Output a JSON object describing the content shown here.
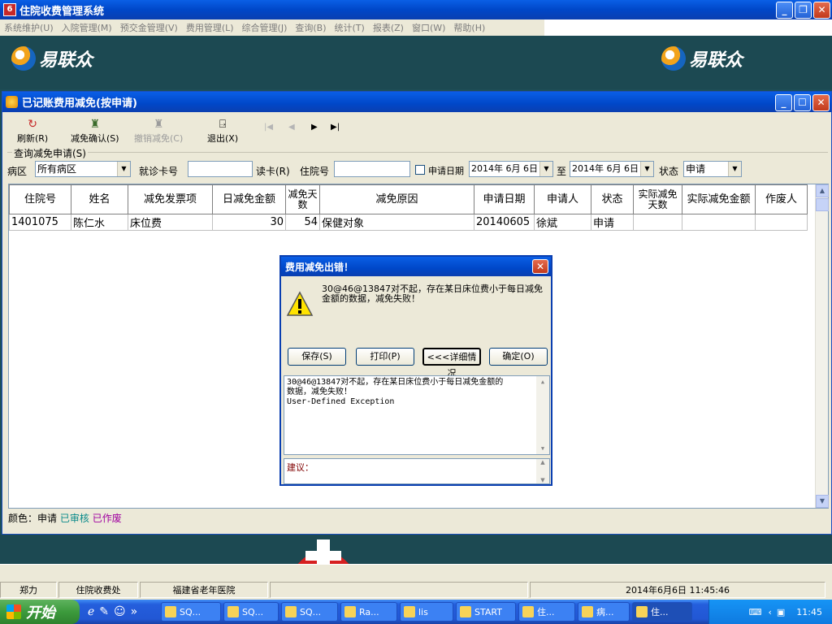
{
  "app": {
    "title": "住院收费管理系统",
    "icon_text": "6"
  },
  "menu": {
    "items": [
      "系统维护(U)",
      "入院管理(M)",
      "预交金管理(V)",
      "费用管理(L)",
      "综合管理(J)",
      "查询(B)",
      "统计(T)",
      "报表(Z)",
      "窗口(W)",
      "帮助(H)"
    ]
  },
  "banner": {
    "logo_text": "易联众"
  },
  "child": {
    "title": "已记账费用减免(按申请)",
    "toolbar": {
      "refresh": "刷新(R)",
      "confirm": "减免确认(S)",
      "cancel": "撤销减免(C)",
      "exit": "退出(X)",
      "nav_first": "|◀",
      "nav_prev": "◀",
      "nav_next": "▶",
      "nav_last": "▶|"
    },
    "query": {
      "legend": "查询减免申请(S)",
      "ward_label": "病区",
      "ward_value": "所有病区",
      "card_label": "就诊卡号",
      "card_value": "",
      "read_card": "读卡(R)",
      "inpatient_label": "住院号",
      "inpatient_value": "",
      "date_check_label": "申请日期",
      "date_from": "2014年 6月 6日",
      "date_to_label": "至",
      "date_to": "2014年 6月 6日",
      "status_label": "状态",
      "status_value": "申请"
    },
    "table": {
      "headers": [
        "住院号",
        "姓名",
        "减免发票项",
        "日减免金额",
        "减免天数",
        "减免原因",
        "申请日期",
        "申请人",
        "状态",
        "实际减免天数",
        "实际减免金额",
        "作废人"
      ],
      "rows": [
        [
          "1401075",
          "陈仁水",
          "床位费",
          "30",
          "54",
          "保健对象",
          "20140605",
          "徐斌",
          "申请",
          "",
          "",
          ""
        ]
      ]
    },
    "legend": {
      "prefix": "颜色：申请",
      "approved": "已审核",
      "void": "已作废"
    }
  },
  "dialog": {
    "title": "费用减免出错！",
    "message": "30@46@13847对不起，存在某日床位费小于每日减免金额的数据，减免失败！",
    "buttons": {
      "save": "保存(S)",
      "print": "打印(P)",
      "details": "<<<详细情况",
      "ok": "确定(O)"
    },
    "detail_line1": "30@46@13847对不起，存在某日床位费小于每日减免金额的",
    "detail_line2": "数据，减免失败！",
    "detail_line3": "User-Defined Exception",
    "suggest_label": "建议："
  },
  "statusbar": {
    "user": "郑力",
    "dept": "住院收费处",
    "hospital": "福建省老年医院",
    "datetime": "2014年6月6日 11:45:46"
  },
  "taskbar": {
    "start": "开始",
    "tasks": [
      "SQ...",
      "SQ...",
      "SQ...",
      "Ra...",
      "lis",
      "START",
      "住...",
      "病...",
      "住..."
    ],
    "clock": "11:45"
  },
  "colors": {
    "titlebar": "#0047c8",
    "banner": "#1c4952",
    "approved": "#0a8a8a",
    "void": "#a000a0"
  }
}
